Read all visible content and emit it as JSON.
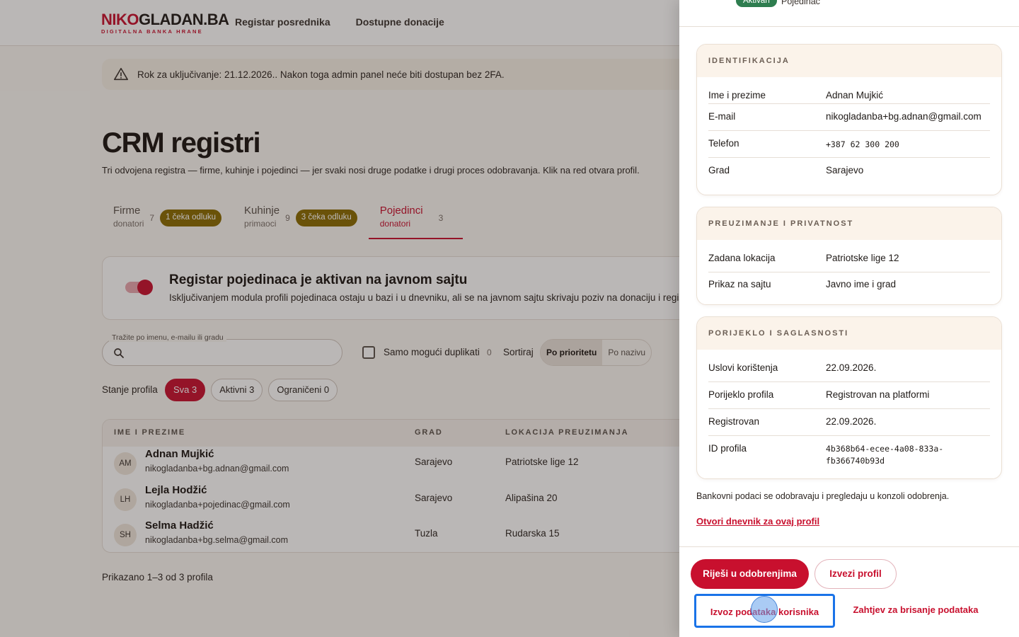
{
  "brand": {
    "logo_primary": "NIKO",
    "logo_secondary": "GLADAN.BA",
    "logo_sub": "DIGITALNA BANKA HRANE",
    "accent": "#c8102e"
  },
  "nav": {
    "items": [
      "Registar posrednika",
      "Dostupne donacije"
    ]
  },
  "alert": {
    "text": "Rok za uključivanje: 21.12.2026.. Nakon toga admin panel neće biti dostupan bez 2FA."
  },
  "page": {
    "title": "CRM registri",
    "lead": "Tri odvojena registra — firme, kuhinje i pojedinci — jer svaki nosi druge podatke i drugi proces odobravanja. Klik na red otvara profil."
  },
  "tabs": [
    {
      "name": "Firme",
      "sub": "donatori",
      "count": "7",
      "badge": "1 čeka odluku"
    },
    {
      "name": "Kuhinje",
      "sub": "primaoci",
      "count": "9",
      "badge": "3 čeka odluku"
    },
    {
      "name": "Pojedinci",
      "sub": "donatori",
      "count": "3",
      "badge": ""
    }
  ],
  "module": {
    "title": "Registar pojedinaca je aktivan na javnom sajtu",
    "desc": "Isključivanjem modula profili pojedinaca ostaju u bazi i u dnevniku, ali se na javnom sajtu skrivaju poziv na donaciju i regis"
  },
  "filters": {
    "search_label": "Tražite po imenu, e-mailu ili gradu",
    "search_value": "",
    "duplicates_label": "Samo mogući duplikati",
    "duplicates_count": "0",
    "sort_label": "Sortiraj",
    "sort_options": [
      "Po prioritetu",
      "Po nazivu"
    ],
    "state_label": "Stanje profila",
    "state_pills": [
      "Sva 3",
      "Aktivni 3",
      "Ograničeni 0"
    ]
  },
  "table": {
    "headers": [
      "IME I PREZIME",
      "GRAD",
      "LOKACIJA PREUZIMANJA"
    ],
    "rows": [
      {
        "initials": "AM",
        "name": "Adnan Mujkić",
        "email": "nikogladanba+bg.adnan@gmail.com",
        "city": "Sarajevo",
        "location": "Patriotske lige 12"
      },
      {
        "initials": "LH",
        "name": "Lejla Hodžić",
        "email": "nikogladanba+pojedinac@gmail.com",
        "city": "Sarajevo",
        "location": "Alipašina 20"
      },
      {
        "initials": "SH",
        "name": "Selma Hadžić",
        "email": "nikogladanba+bg.selma@gmail.com",
        "city": "Tuzla",
        "location": "Rudarska 15"
      }
    ],
    "footer": "Prikazano 1–3 od 3 profila"
  },
  "drawer": {
    "status_badge": "Aktivan",
    "type": "Pojedinac",
    "sections": [
      {
        "title": "IDENTIFIKACIJA",
        "rows": [
          {
            "k": "Ime i prezime",
            "v": "Adnan Mujkić"
          },
          {
            "k": "E-mail",
            "v": "nikogladanba+bg.adnan@gmail.com"
          },
          {
            "k": "Telefon",
            "v": "+387 62 300 200"
          },
          {
            "k": "Grad",
            "v": "Sarajevo"
          }
        ]
      },
      {
        "title": "PREUZIMANJE I PRIVATNOST",
        "rows": [
          {
            "k": "Zadana lokacija",
            "v": "Patriotske lige 12"
          },
          {
            "k": "Prikaz na sajtu",
            "v": "Javno ime i grad"
          }
        ]
      },
      {
        "title": "PORIJEKLO I SAGLASNOSTI",
        "rows": [
          {
            "k": "Uslovi korištenja",
            "v": "22.09.2026."
          },
          {
            "k": "Porijeklo profila",
            "v": "Registrovan na platformi"
          },
          {
            "k": "Registrovan",
            "v": "22.09.2026."
          },
          {
            "k": "ID profila",
            "v": "4b368b64-ecee-4a08-833a-",
            "v2": "fb366740b93d"
          }
        ]
      }
    ],
    "bank_info": "Bankovni podaci se odobravaju i pregledaju u konzoli odobrenja.",
    "log_link": "Otvori dnevnik za ovaj profil",
    "actions": {
      "resolve": "Riješi u odobrenjima",
      "export_profile": "Izvezi profil",
      "export_data": "Izvoz podataka korisnika",
      "delete_request": "Zahtjev za brisanje podataka"
    }
  }
}
